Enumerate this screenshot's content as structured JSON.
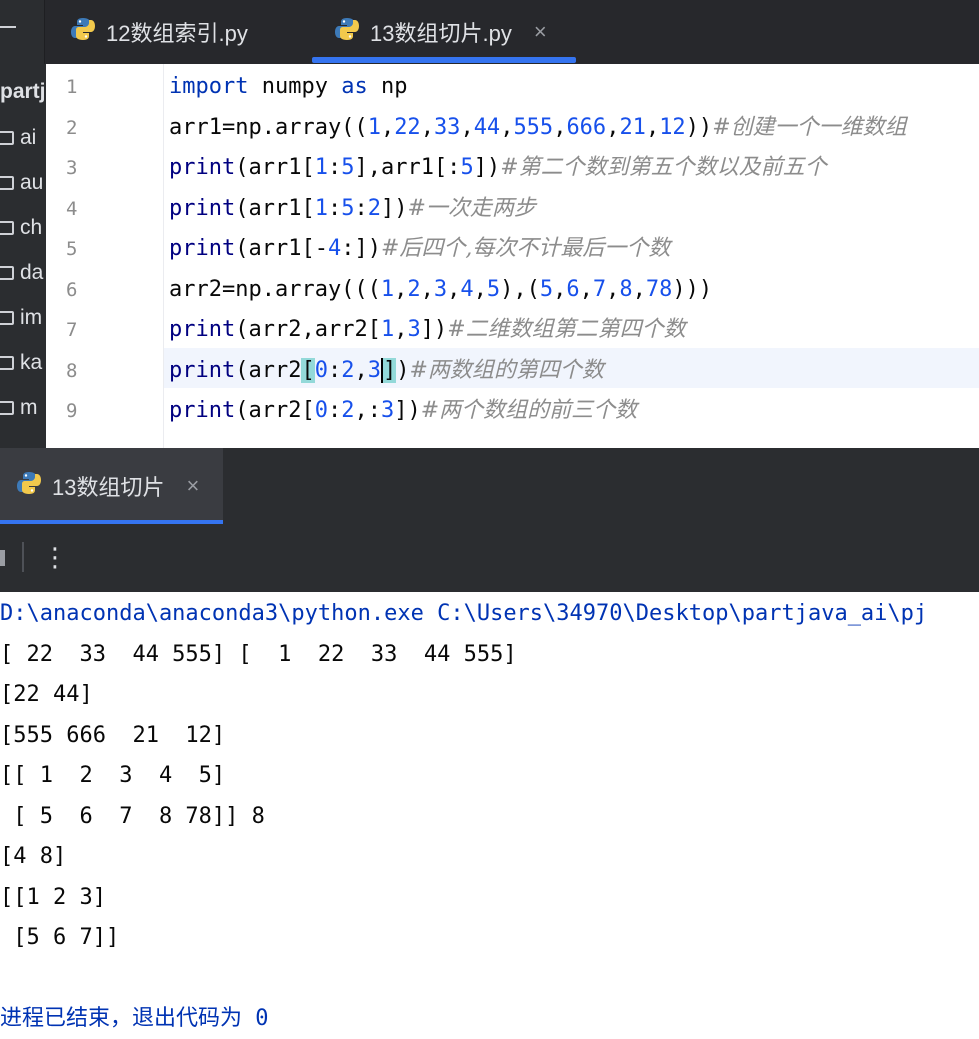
{
  "tabs": [
    {
      "label": "12数组索引.py",
      "active": false
    },
    {
      "label": "13数组切片.py",
      "active": true,
      "close": "×"
    }
  ],
  "project": {
    "title": "partj",
    "folders": [
      "ai",
      "au",
      "ch",
      "da",
      "im",
      "ka",
      "m"
    ]
  },
  "editor": {
    "current_line": 8,
    "lines": [
      {
        "n": "1",
        "html": "<span class=\"kw\">import</span> numpy <span class=\"kw\">as</span> np"
      },
      {
        "n": "2",
        "html": "arr1=np.array((<span class=\"num\">1</span>,<span class=\"num\">22</span>,<span class=\"num\">33</span>,<span class=\"num\">44</span>,<span class=\"num\">555</span>,<span class=\"num\">666</span>,<span class=\"num\">21</span>,<span class=\"num\">12</span>))<span class=\"cmt\">#创建一个一维数组</span>"
      },
      {
        "n": "3",
        "html": "<span class=\"fn\">print</span>(arr1[<span class=\"num\">1</span>:<span class=\"num\">5</span>],arr1[:<span class=\"num\">5</span>])<span class=\"cmt\">#第二个数到第五个数以及前五个</span>"
      },
      {
        "n": "4",
        "html": "<span class=\"fn\">print</span>(arr1[<span class=\"num\">1</span>:<span class=\"num\">5</span>:<span class=\"num\">2</span>])<span class=\"cmt\">#一次走两步</span>"
      },
      {
        "n": "5",
        "html": "<span class=\"fn\">print</span>(arr1[-<span class=\"num\">4</span>:])<span class=\"cmt\">#后四个,每次不计最后一个数</span>"
      },
      {
        "n": "6",
        "html": "arr2=np.array(((<span class=\"num\">1</span>,<span class=\"num\">2</span>,<span class=\"num\">3</span>,<span class=\"num\">4</span>,<span class=\"num\">5</span>),(<span class=\"num\">5</span>,<span class=\"num\">6</span>,<span class=\"num\">7</span>,<span class=\"num\">8</span>,<span class=\"num\">78</span>)))"
      },
      {
        "n": "7",
        "html": "<span class=\"fn\">print</span>(arr2,arr2[<span class=\"num\">1</span>,<span class=\"num\">3</span>])<span class=\"cmt\">#二维数组第二第四个数</span>"
      },
      {
        "n": "8",
        "html": "<span class=\"fn\">print</span>(arr2<span class=\"brk\">[</span><span class=\"num\">0</span>:<span class=\"num\">2</span>,<span class=\"num\">3</span><span class=\"brk caret\">]</span>)<span class=\"cmt\">#两数组的第四个数</span>"
      },
      {
        "n": "9",
        "html": "<span class=\"fn\">print</span>(arr2[<span class=\"num\">0</span>:<span class=\"num\">2</span>,:<span class=\"num\">3</span>])<span class=\"cmt\">#两个数组的前三个数</span>"
      }
    ]
  },
  "run": {
    "tab_label": "13数组切片",
    "tab_close": "×",
    "more_label": "⋮",
    "output": [
      {
        "text": "D:\\anaconda\\anaconda3\\python.exe C:\\Users\\34970\\Desktop\\partjava_ai\\pj",
        "kind": "path"
      },
      {
        "text": "[ 22  33  44 555] [  1  22  33  44 555]",
        "kind": "out"
      },
      {
        "text": "[22 44]",
        "kind": "out"
      },
      {
        "text": "[555 666  21  12]",
        "kind": "out"
      },
      {
        "text": "[[ 1  2  3  4  5]",
        "kind": "out"
      },
      {
        "text": " [ 5  6  7  8 78]] 8",
        "kind": "out"
      },
      {
        "text": "[4 8]",
        "kind": "out"
      },
      {
        "text": "[[1 2 3]",
        "kind": "out"
      },
      {
        "text": " [5 6 7]]",
        "kind": "out"
      },
      {
        "text": "",
        "kind": "out"
      },
      {
        "text": "进程已结束，退出代码为 0",
        "kind": "exit"
      }
    ]
  },
  "colors": {
    "accent": "#3574f0",
    "dark_bg": "#2b2d30",
    "keyword": "#0033b3",
    "number": "#1750eb",
    "comment": "#8c8c8c"
  }
}
